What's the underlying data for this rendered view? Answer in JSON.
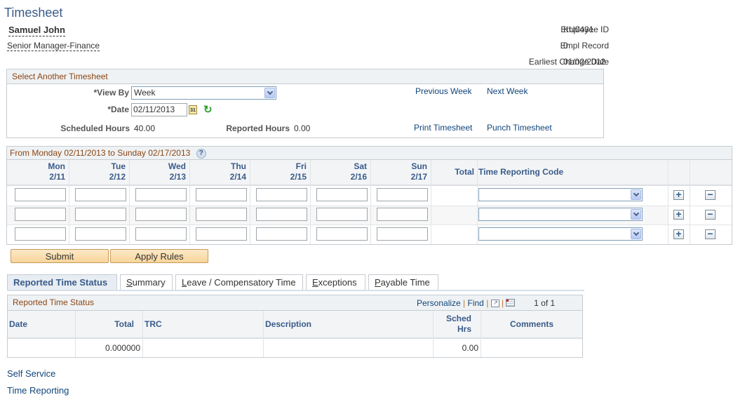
{
  "page": {
    "title": "Timesheet"
  },
  "employee": {
    "name": "Samuel John",
    "job_title": "Senior Manager-Finance",
    "fields": [
      {
        "label": "Employee ID",
        "value": "KU0431"
      },
      {
        "label": "Empl Record",
        "value": "0"
      },
      {
        "label": "Earliest Change Date",
        "value": "01/02/2012"
      }
    ]
  },
  "select_timesheet": {
    "header": "Select Another Timesheet",
    "view_by_label": "*View By",
    "view_by_value": "Week",
    "date_label": "*Date",
    "date_value": "02/11/2013",
    "calendar_icon_text": "31",
    "scheduled_hours_label": "Scheduled Hours",
    "scheduled_hours_value": "40.00",
    "reported_hours_label": "Reported Hours",
    "reported_hours_value": "0.00",
    "links": {
      "previous_week": "Previous Week",
      "next_week": "Next Week",
      "print_timesheet": "Print Timesheet",
      "punch_timesheet": "Punch Timesheet"
    }
  },
  "time_grid": {
    "header": "From Monday 02/11/2013 to Sunday 02/17/2013",
    "help_icon": "?",
    "days": [
      {
        "day": "Mon",
        "date": "2/11"
      },
      {
        "day": "Tue",
        "date": "2/12"
      },
      {
        "day": "Wed",
        "date": "2/13"
      },
      {
        "day": "Thu",
        "date": "2/14"
      },
      {
        "day": "Fri",
        "date": "2/15"
      },
      {
        "day": "Sat",
        "date": "2/16"
      },
      {
        "day": "Sun",
        "date": "2/17"
      }
    ],
    "total_label": "Total",
    "trc_label": "Time Reporting Code",
    "rows": [
      {
        "hours": [
          "",
          "",
          "",
          "",
          "",
          "",
          ""
        ],
        "total": "",
        "trc": ""
      },
      {
        "hours": [
          "",
          "",
          "",
          "",
          "",
          "",
          ""
        ],
        "total": "",
        "trc": ""
      },
      {
        "hours": [
          "",
          "",
          "",
          "",
          "",
          "",
          ""
        ],
        "total": "",
        "trc": ""
      }
    ],
    "add_row_symbol": "+",
    "delete_row_symbol": "−"
  },
  "actions": {
    "submit": "Submit",
    "apply_rules": "Apply Rules"
  },
  "tabs": [
    {
      "label": "Reported Time Status",
      "active": true
    },
    {
      "label": "Summary",
      "accesskey": "S",
      "rest": "ummary"
    },
    {
      "label": "Leave / Compensatory Time",
      "accesskey": "L",
      "rest": "eave / Compensatory Time"
    },
    {
      "label": "Exceptions",
      "accesskey": "E",
      "rest": "xceptions"
    },
    {
      "label": "Payable Time",
      "accesskey": "P",
      "rest": "ayable Time"
    }
  ],
  "reported_status": {
    "header": "Reported Time Status",
    "toolbar": {
      "personalize": "Personalize",
      "find": "Find",
      "separator": "|",
      "pagination": "1 of 1"
    },
    "columns": [
      "Date",
      "Total",
      "TRC",
      "Description",
      "Sched Hrs",
      "Comments"
    ],
    "sched_hrs_line1": "Sched",
    "sched_hrs_line2": "Hrs",
    "rows": [
      {
        "date": "",
        "total": "0.000000",
        "trc": "",
        "description": "",
        "sched_hrs": "0.00",
        "comments": ""
      }
    ]
  },
  "footer_links": [
    "Self Service",
    "Time Reporting"
  ]
}
